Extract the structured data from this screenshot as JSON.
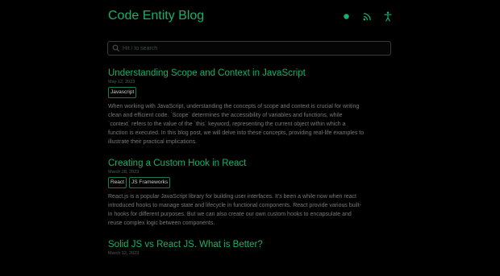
{
  "site": {
    "title": "Code Entity Blog",
    "accent_color": "#16b06a",
    "background_color": "#000000"
  },
  "header_icons": [
    "theme-toggle-icon",
    "rss-icon",
    "accessibility-icon"
  ],
  "search": {
    "placeholder": "Hit / to search",
    "value": ""
  },
  "posts": [
    {
      "title": "Understanding Scope and Context in JavaScript",
      "date": "May 12, 2023",
      "tags": [
        "Javascript"
      ],
      "excerpt": "When working with JavaScript, understanding the concepts of scope and context is crucial for writing\nclean and efficient code. `Scope` determines the accessibility of variables and functions, while\n`context` refers to the value of the `this` keyword, representing the current object within which a\nfunction is executed. In this blog post, we will delve into these concepts, providing real-life examples to\nillustrate their practical implications."
    },
    {
      "title": "Creating a Custom Hook in React",
      "date": "March 28, 2023",
      "tags": [
        "React",
        "JS Frameworks"
      ],
      "excerpt": "React.js is a popular JavaScript library for building user interfaces. It's been a while now when react\nintroduced hooks to manage state and lifecycle in functional components. React provide various built-\nin hooks for different purposes. But we can also create our own custom hooks to encapsulate and\nreuse complex logic between components."
    },
    {
      "title": "Solid JS vs React JS. What is Better?",
      "date": "March 12, 2023",
      "tags": [],
      "excerpt": ""
    }
  ]
}
